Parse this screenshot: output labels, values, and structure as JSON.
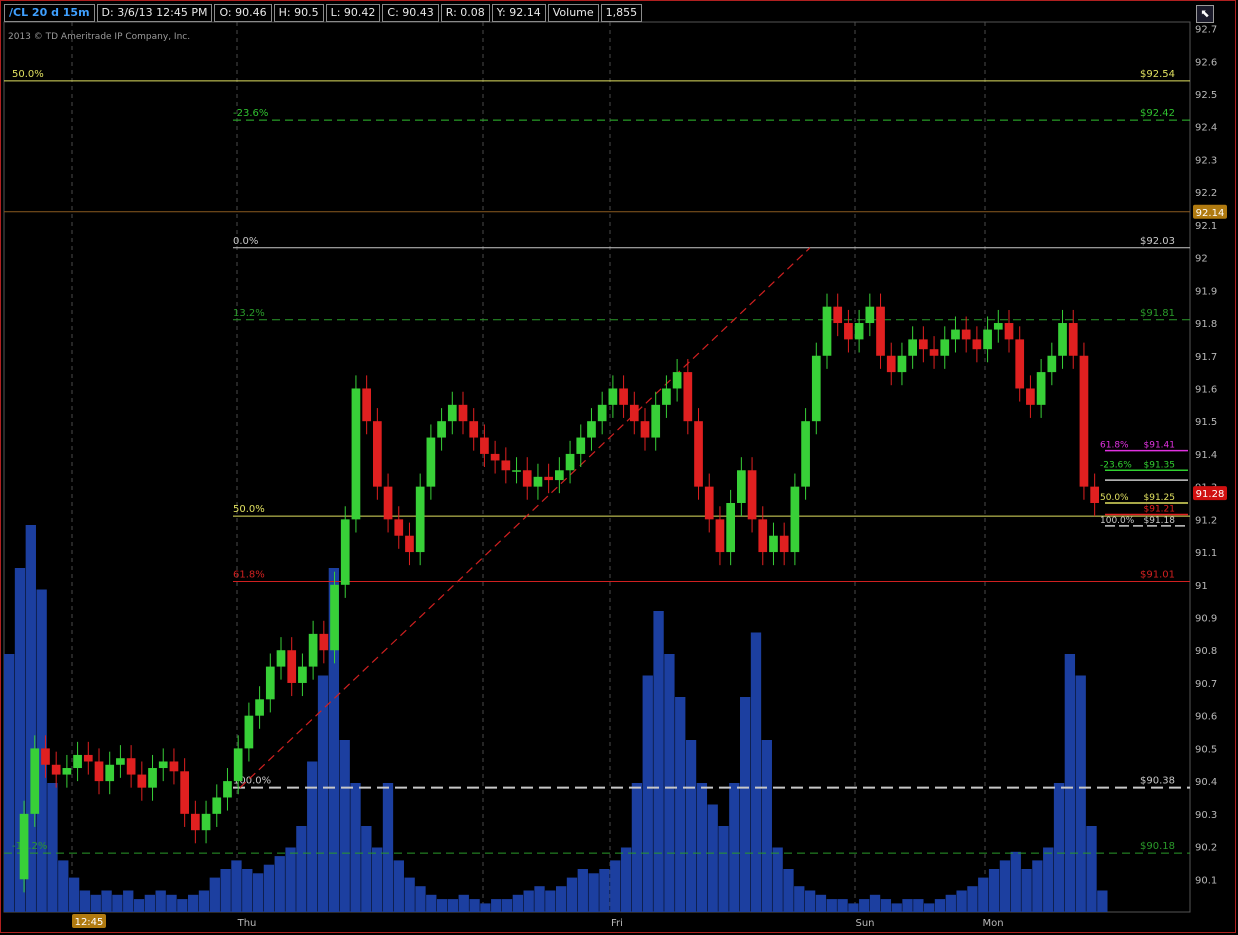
{
  "header": {
    "symbol": "/CL 20 d 15m",
    "date": "D: 3/6/13 12:45 PM",
    "open": "O: 90.46",
    "high": "H: 90.5",
    "low": "L: 90.42",
    "close": "C: 90.43",
    "range": "R: 0.08",
    "y": "Y: 92.14",
    "volume_label": "Volume",
    "volume_value": "1,855"
  },
  "copyright": "2013 © TD Ameritrade IP Company, Inc.",
  "colors": {
    "up_candle": "#38d038",
    "down_candle": "#e02020",
    "volume": "#1c3fa0",
    "grid": "#4a4a4a",
    "axis_text": "#b8b8b8",
    "price_marker": "#b07a10",
    "last_price_marker": "#d01010"
  },
  "chart_data": {
    "type": "candlestick",
    "ylim": [
      90.0,
      92.72
    ],
    "y_ticks": [
      "90.1",
      "90.2",
      "90.3",
      "90.4",
      "90.5",
      "90.6",
      "90.7",
      "90.8",
      "90.9",
      "91",
      "91.1",
      "91.2",
      "91.3",
      "91.4",
      "91.5",
      "91.6",
      "91.7",
      "91.8",
      "91.9",
      "92",
      "92.1",
      "92.2",
      "92.3",
      "92.4",
      "92.5",
      "92.6",
      "92.7"
    ],
    "x_labels": [
      "12:45",
      "Thu",
      "Fri",
      "Sun",
      "Mon"
    ],
    "crosshair_price": "92.14",
    "last_price": "91.28",
    "fib_levels": [
      {
        "label": "50.0%",
        "price_label": "$92.54",
        "value": 92.54,
        "color": "#e0e060",
        "style": "solid"
      },
      {
        "label": "-23.6%",
        "price_label": "$92.42",
        "value": 92.42,
        "color": "#30c030",
        "style": "dashed"
      },
      {
        "label": "0.0%",
        "price_label": "$92.03",
        "value": 92.03,
        "color": "#c8c8c8",
        "style": "solid"
      },
      {
        "label": "13.2%",
        "price_label": "$91.81",
        "value": 91.81,
        "color": "#2a9a2a",
        "style": "dashed"
      },
      {
        "label": "50.0%",
        "price_label": "",
        "value": 91.21,
        "color": "#e0e060",
        "style": "solid"
      },
      {
        "label": "61.8%",
        "price_label": "$91.01",
        "value": 91.01,
        "color": "#d02020",
        "style": "solid"
      },
      {
        "label": "100.0%",
        "price_label": "$90.38",
        "value": 90.38,
        "color": "#c8c8c8",
        "style": "dashed"
      },
      {
        "label": "-13.2%",
        "price_label": "$90.18",
        "value": 90.18,
        "color": "#2a9a2a",
        "style": "dashed"
      }
    ],
    "small_fib": [
      {
        "label": "61.8%",
        "price_label": "$91.41",
        "value": 91.41,
        "color": "#e030e0"
      },
      {
        "label": "-23.6%",
        "price_label": "$91.35",
        "value": 91.35,
        "color": "#30d030"
      },
      {
        "label": "",
        "price_label": "",
        "value": 91.32,
        "color": "#c8c8c8"
      },
      {
        "label": "50.0%",
        "price_label": "$91.25",
        "value": 91.25,
        "color": "#e0e060"
      },
      {
        "label": "",
        "price_label": "$91.21",
        "value": 91.215,
        "color": "#e02020"
      },
      {
        "label": "100.0%",
        "price_label": "$91.18",
        "value": 91.18,
        "color": "#c8c8c8"
      }
    ],
    "trendline": {
      "from": [
        90.5
      ],
      "to": [
        92.03
      ]
    },
    "price_path": [
      90.1,
      90.3,
      90.5,
      90.45,
      90.42,
      90.44,
      90.48,
      90.46,
      90.4,
      90.45,
      90.47,
      90.42,
      90.38,
      90.44,
      90.46,
      90.43,
      90.3,
      90.25,
      90.3,
      90.35,
      90.4,
      90.5,
      90.6,
      90.65,
      90.75,
      90.8,
      90.7,
      90.75,
      90.85,
      90.8,
      91.0,
      91.2,
      91.6,
      91.5,
      91.3,
      91.2,
      91.15,
      91.1,
      91.3,
      91.45,
      91.5,
      91.55,
      91.5,
      91.45,
      91.4,
      91.38,
      91.35,
      91.35,
      91.3,
      91.33,
      91.32,
      91.35,
      91.4,
      91.45,
      91.5,
      91.55,
      91.6,
      91.55,
      91.5,
      91.45,
      91.55,
      91.6,
      91.65,
      91.5,
      91.3,
      91.2,
      91.1,
      91.25,
      91.35,
      91.2,
      91.1,
      91.15,
      91.1,
      91.3,
      91.5,
      91.7,
      91.85,
      91.8,
      91.75,
      91.8,
      91.85,
      91.7,
      91.65,
      91.7,
      91.75,
      91.72,
      91.7,
      91.75,
      91.78,
      91.75,
      91.72,
      91.78,
      91.8,
      91.75,
      91.6,
      91.55,
      91.65,
      91.7,
      91.8,
      91.7,
      91.3,
      91.25
    ],
    "volume": [
      0.6,
      0.8,
      0.9,
      0.75,
      0.3,
      0.12,
      0.08,
      0.05,
      0.04,
      0.05,
      0.04,
      0.05,
      0.03,
      0.04,
      0.05,
      0.04,
      0.03,
      0.04,
      0.05,
      0.08,
      0.1,
      0.12,
      0.1,
      0.09,
      0.11,
      0.13,
      0.15,
      0.2,
      0.35,
      0.55,
      0.8,
      0.4,
      0.3,
      0.2,
      0.15,
      0.3,
      0.12,
      0.08,
      0.06,
      0.04,
      0.03,
      0.03,
      0.04,
      0.03,
      0.02,
      0.03,
      0.03,
      0.04,
      0.05,
      0.06,
      0.05,
      0.06,
      0.08,
      0.1,
      0.09,
      0.1,
      0.12,
      0.15,
      0.3,
      0.55,
      0.7,
      0.6,
      0.5,
      0.4,
      0.3,
      0.25,
      0.2,
      0.3,
      0.5,
      0.65,
      0.4,
      0.15,
      0.1,
      0.06,
      0.05,
      0.04,
      0.03,
      0.03,
      0.02,
      0.03,
      0.04,
      0.03,
      0.02,
      0.03,
      0.03,
      0.02,
      0.03,
      0.04,
      0.05,
      0.06,
      0.08,
      0.1,
      0.12,
      0.14,
      0.1,
      0.12,
      0.15,
      0.3,
      0.6,
      0.55,
      0.2,
      0.05
    ]
  }
}
